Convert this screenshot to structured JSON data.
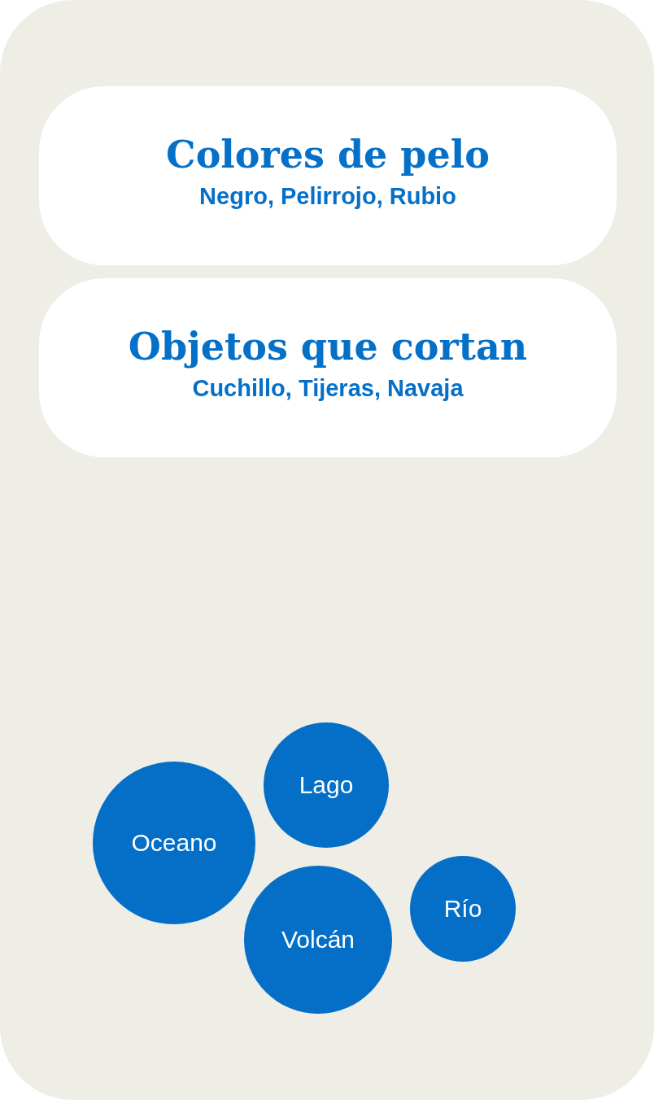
{
  "groups": [
    {
      "title": "Colores de pelo",
      "words": "Negro, Pelirrojo, Rubio"
    },
    {
      "title": "Objetos que cortan",
      "words": "Cuchillo, Tijeras, Navaja"
    }
  ],
  "bubbles": [
    {
      "label": "Oceano"
    },
    {
      "label": "Lago"
    },
    {
      "label": "Volcán"
    },
    {
      "label": "Río"
    }
  ]
}
